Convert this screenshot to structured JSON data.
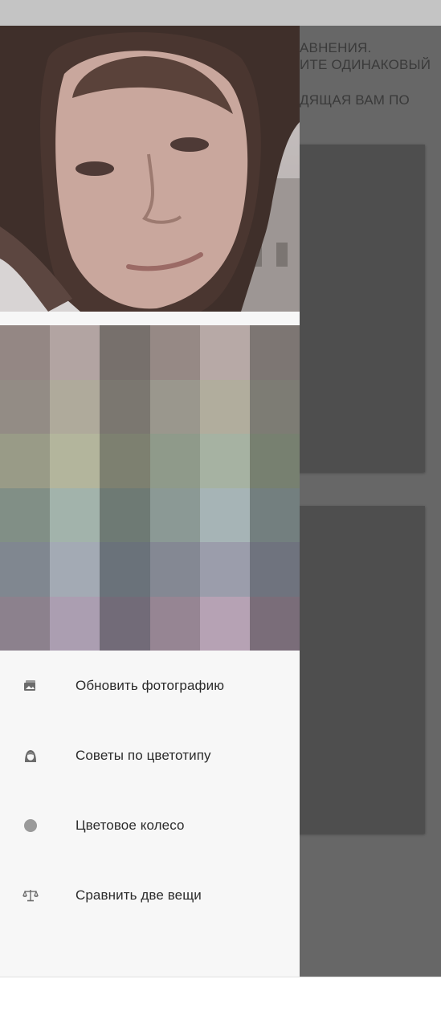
{
  "background": {
    "lines": [
      "АВНЕНИЯ.",
      "ИТЕ ОДИНАКОВЫЙ",
      "ДЯЩАЯ ВАМ ПО"
    ]
  },
  "drawer": {
    "photo": {
      "icon": "user-portrait-photo"
    },
    "palette": {
      "swatches": [
        "#948784",
        "#b2a4a2",
        "#77706c",
        "#968985",
        "#b7a9a6",
        "#7d7673",
        "#938c85",
        "#afaa9b",
        "#7b7770",
        "#9a978d",
        "#b1ad9d",
        "#7d7c74",
        "#999b87",
        "#b3b59c",
        "#7d8070",
        "#8f9a8a",
        "#a6b2a2",
        "#778070",
        "#818f86",
        "#a2b3ab",
        "#6e7a74",
        "#8b9995",
        "#a6b4b6",
        "#737f7f",
        "#808790",
        "#a3aab4",
        "#6a727a",
        "#848893",
        "#9b9dab",
        "#6f737e",
        "#8c818d",
        "#ab9eb1",
        "#726b78",
        "#968593",
        "#b6a2b4",
        "#7a6d79"
      ]
    },
    "menu": [
      {
        "label": "Обновить фотографию",
        "icon": "photos-icon"
      },
      {
        "label": "Советы по цветотипу",
        "icon": "woman-icon"
      },
      {
        "label": "Цветовое колесо",
        "icon": "circle-icon"
      },
      {
        "label": "Сравнить две вещи",
        "icon": "scales-icon"
      }
    ]
  }
}
